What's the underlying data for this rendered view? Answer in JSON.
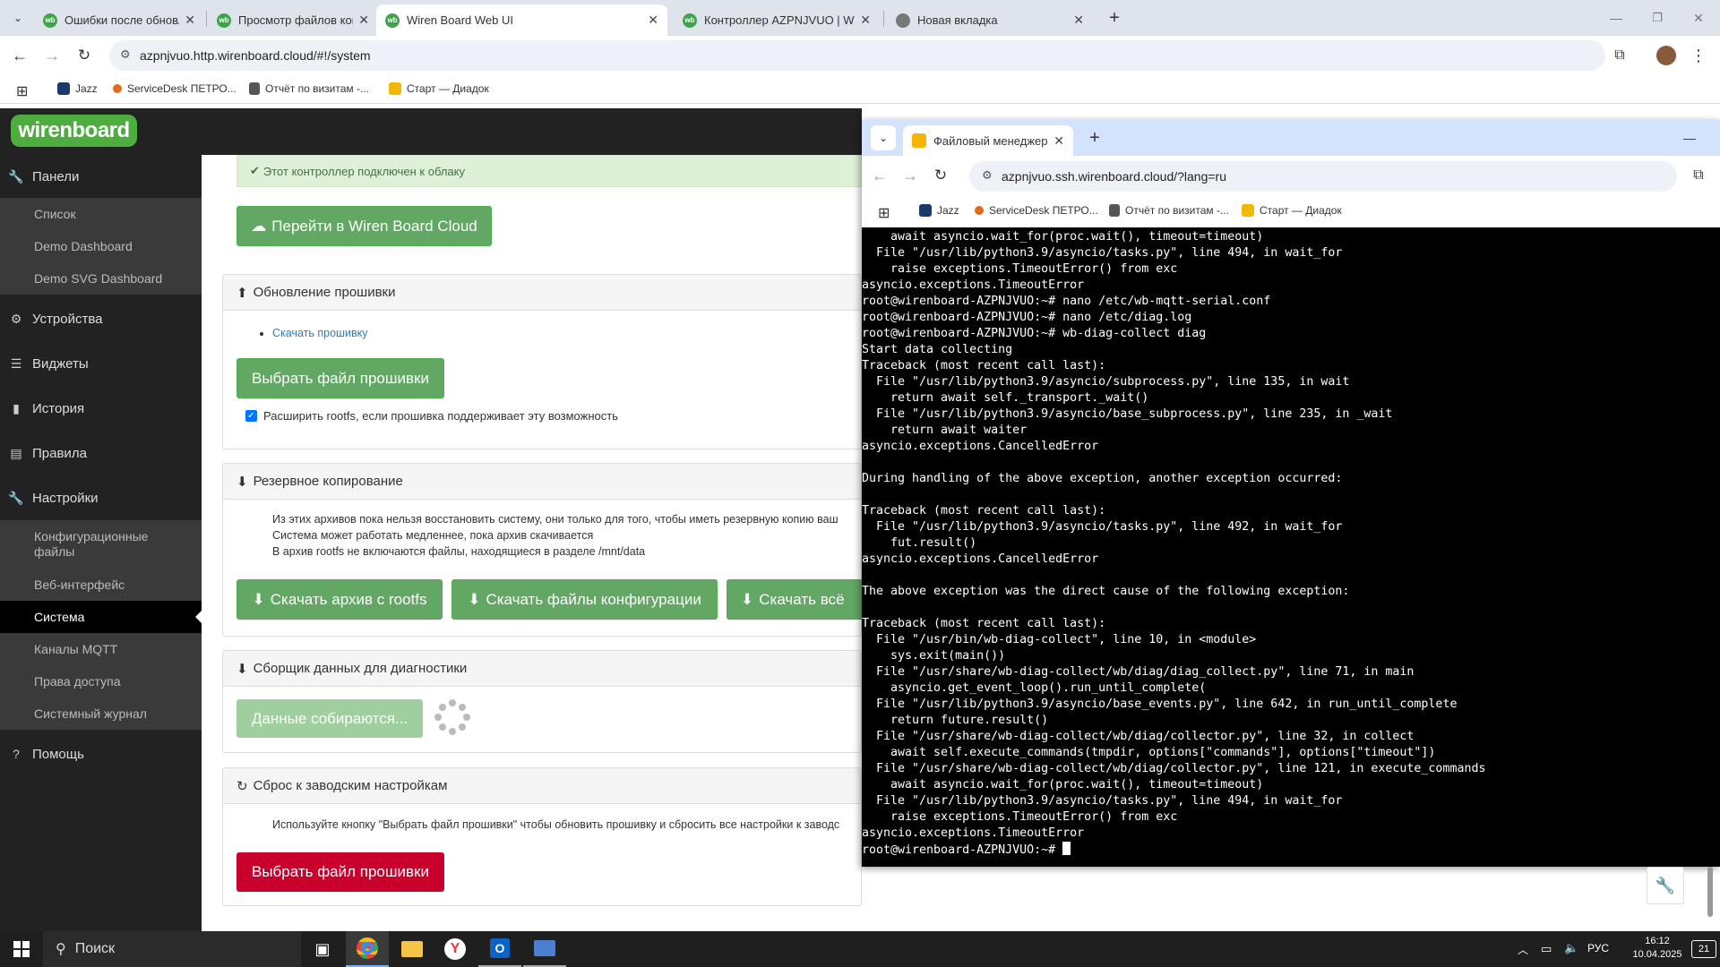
{
  "browser": {
    "tabs": [
      {
        "title": "Ошибки после обновления - W",
        "active": false
      },
      {
        "title": "Просмотр файлов контроллер",
        "active": false
      },
      {
        "title": "Wiren Board Web UI",
        "active": true
      },
      {
        "title": "Контроллер AZPNJVUO | Wire",
        "active": false
      },
      {
        "title": "Новая вкладка",
        "active": false
      }
    ],
    "url": "azpnjvuo.http.wirenboard.cloud/#!/system",
    "bookmarks": [
      "Jazz",
      "ServiceDesk ПЕТРО...",
      "Отчёт по визитам -...",
      "Старт — Диадок"
    ]
  },
  "app": {
    "logo": "wirenboard",
    "sidebar": {
      "panels": "Панели",
      "panels_sub": [
        "Список",
        "Demo Dashboard",
        "Demo SVG Dashboard"
      ],
      "devices": "Устройства",
      "widgets": "Виджеты",
      "history": "История",
      "rules": "Правила",
      "settings": "Настройки",
      "settings_sub": [
        "Конфигурационные файлы",
        "Веб-интерфейс",
        "Система",
        "Каналы MQTT",
        "Права доступа",
        "Системный журнал"
      ],
      "help": "Помощь"
    },
    "cloud": {
      "status": "Этот контроллер подключен к облаку",
      "button": "Перейти в Wiren Board Cloud"
    },
    "firmware": {
      "title": "Обновление прошивки",
      "download_link": "Скачать прошивку",
      "button": "Выбрать файл прошивки",
      "checkbox_label": "Расширить rootfs, если прошивка поддерживает эту возможность",
      "checkbox_checked": true
    },
    "backup": {
      "title": "Резервное копирование",
      "notes": [
        "Из этих архивов пока нельзя восстановить систему, они только для того, чтобы иметь резервную копию ваш",
        "Система может работать медленнее, пока архив скачивается",
        "В архив rootfs не включаются файлы, находящиеся в разделе /mnt/data"
      ],
      "buttons": [
        "Скачать архив с rootfs",
        "Скачать файлы конфигурации",
        "Скачать всё"
      ]
    },
    "diag": {
      "title": "Сборщик данных для диагностики",
      "button": "Данные собираются..."
    },
    "reset": {
      "title": "Сброс к заводским настройкам",
      "note": "Используйте кнопку \"Выбрать файл прошивки\" чтобы обновить прошивку и сбросить все настройки к заводс",
      "button": "Выбрать файл прошивки"
    }
  },
  "terminal_window": {
    "tab_title": "Файловый менеджер и SSH | W",
    "url": "azpnjvuo.ssh.wirenboard.cloud/?lang=ru",
    "bookmarks": [
      "Jazz",
      "ServiceDesk ПЕТРО...",
      "Отчёт по визитам -...",
      "Старт — Диадок"
    ],
    "lines": [
      "    await asyncio.wait_for(proc.wait(), timeout=timeout)",
      "  File \"/usr/lib/python3.9/asyncio/tasks.py\", line 494, in wait_for",
      "    raise exceptions.TimeoutError() from exc",
      "asyncio.exceptions.TimeoutError",
      "root@wirenboard-AZPNJVUO:~# nano /etc/wb-mqtt-serial.conf",
      "root@wirenboard-AZPNJVUO:~# nano /etc/diag.log",
      "root@wirenboard-AZPNJVUO:~# wb-diag-collect diag",
      "Start data collecting",
      "Traceback (most recent call last):",
      "  File \"/usr/lib/python3.9/asyncio/subprocess.py\", line 135, in wait",
      "    return await self._transport._wait()",
      "  File \"/usr/lib/python3.9/asyncio/base_subprocess.py\", line 235, in _wait",
      "    return await waiter",
      "asyncio.exceptions.CancelledError",
      "",
      "During handling of the above exception, another exception occurred:",
      "",
      "Traceback (most recent call last):",
      "  File \"/usr/lib/python3.9/asyncio/tasks.py\", line 492, in wait_for",
      "    fut.result()",
      "asyncio.exceptions.CancelledError",
      "",
      "The above exception was the direct cause of the following exception:",
      "",
      "Traceback (most recent call last):",
      "  File \"/usr/bin/wb-diag-collect\", line 10, in <module>",
      "    sys.exit(main())",
      "  File \"/usr/share/wb-diag-collect/wb/diag/diag_collect.py\", line 71, in main",
      "    asyncio.get_event_loop().run_until_complete(",
      "  File \"/usr/lib/python3.9/asyncio/base_events.py\", line 642, in run_until_complete",
      "    return future.result()",
      "  File \"/usr/share/wb-diag-collect/wb/diag/collector.py\", line 32, in collect",
      "    await self.execute_commands(tmpdir, options[\"commands\"], options[\"timeout\"])",
      "  File \"/usr/share/wb-diag-collect/wb/diag/collector.py\", line 121, in execute_commands",
      "    await asyncio.wait_for(proc.wait(), timeout=timeout)",
      "  File \"/usr/lib/python3.9/asyncio/tasks.py\", line 494, in wait_for",
      "    raise exceptions.TimeoutError() from exc",
      "asyncio.exceptions.TimeoutError"
    ],
    "prompt": "root@wirenboard-AZPNJVUO:~# "
  },
  "taskbar": {
    "search_placeholder": "Поиск",
    "lang": "РУС",
    "time": "16:12",
    "date": "10.04.2025",
    "notif_count": "21"
  }
}
